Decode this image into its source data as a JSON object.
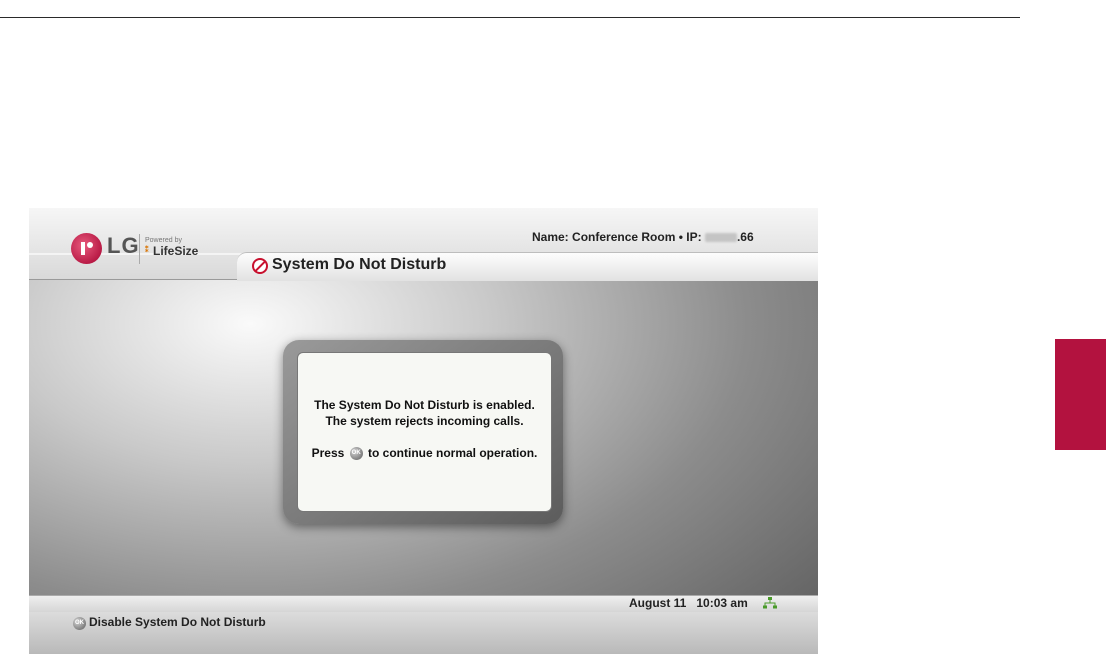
{
  "header": {
    "logo_text": "LG",
    "powered_by": "Powered by",
    "lifesize_text": "LifeSize",
    "name_label": "Name:",
    "name_value": "Conference Room",
    "ip_label": "IP:",
    "ip_value_suffix": ".66"
  },
  "page": {
    "title": "System Do Not Disturb"
  },
  "dialog": {
    "line1": "The System Do Not Disturb is enabled.",
    "line2": "The system rejects incoming calls.",
    "press_prefix": "Press",
    "ok_icon_label": "OK",
    "press_suffix": "to continue normal operation."
  },
  "status": {
    "date": "August 11",
    "time": "10:03 am"
  },
  "bottom_bar": {
    "ok_icon_label": "OK",
    "action_label": "Disable System Do Not Disturb"
  },
  "colors": {
    "brand_red": "#b3123f",
    "dnd_red": "#c8102e",
    "network_green": "#4a9a2a"
  },
  "icons": [
    "lg-logo-icon",
    "do-not-disturb-icon",
    "ok-button-icon",
    "network-status-icon"
  ]
}
